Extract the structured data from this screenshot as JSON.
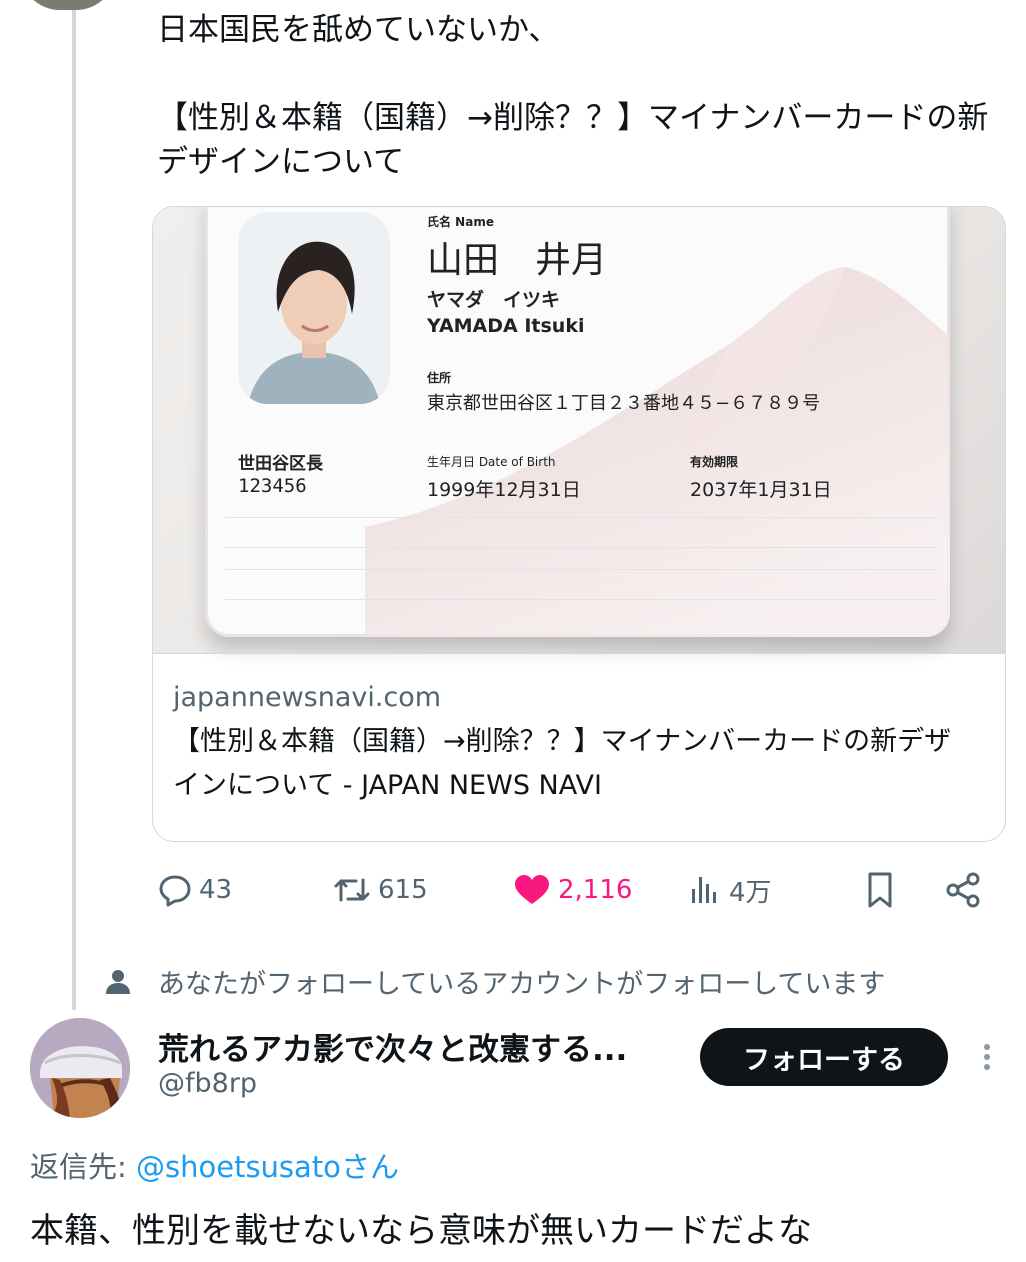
{
  "tweet": {
    "text": "日本国民を舐めていないか、\n\n【性別＆本籍（国籍）→削除？？】マイナンバーカードの新デザインについて"
  },
  "card": {
    "mynumber": {
      "name_label": "氏名 Name",
      "name": "山田　井月",
      "kana": "ヤマダ　イツキ",
      "romaji": "YAMADA Itsuki",
      "address_label": "住所",
      "address": "東京都世田谷区１丁目２３番地４５−６７８９号",
      "issuer": "世田谷区長",
      "issuer_number": "123456",
      "dob_label": "生年月日 Date of Birth",
      "dob": "1999年12月31日",
      "expiry_label": "有効期限",
      "expiry": "2037年1月31日"
    },
    "domain": "japannewsnavi.com",
    "title": "【性別＆本籍（国籍）→削除？？】マイナンバーカードの新デザインについて - JAPAN NEWS NAVI"
  },
  "actions": {
    "replies": "43",
    "reposts": "615",
    "likes": "2,116",
    "views": "4万"
  },
  "colors": {
    "like": "#f91880",
    "link": "#1d9bf0",
    "muted": "#536471",
    "button_bg": "#0f1419"
  },
  "social_context": "あなたがフォローしているアカウントがフォローしています",
  "reply": {
    "display_name": "荒れるアカ影で次々と改憲する...",
    "handle": "@fb8rp",
    "follow_label": "フォローする",
    "reply_to_prefix": "返信先: ",
    "reply_to_handle": "@shoetsusato",
    "reply_to_suffix": "さん",
    "text": "本籍、性別を載せないなら意味が無いカードだよな"
  }
}
